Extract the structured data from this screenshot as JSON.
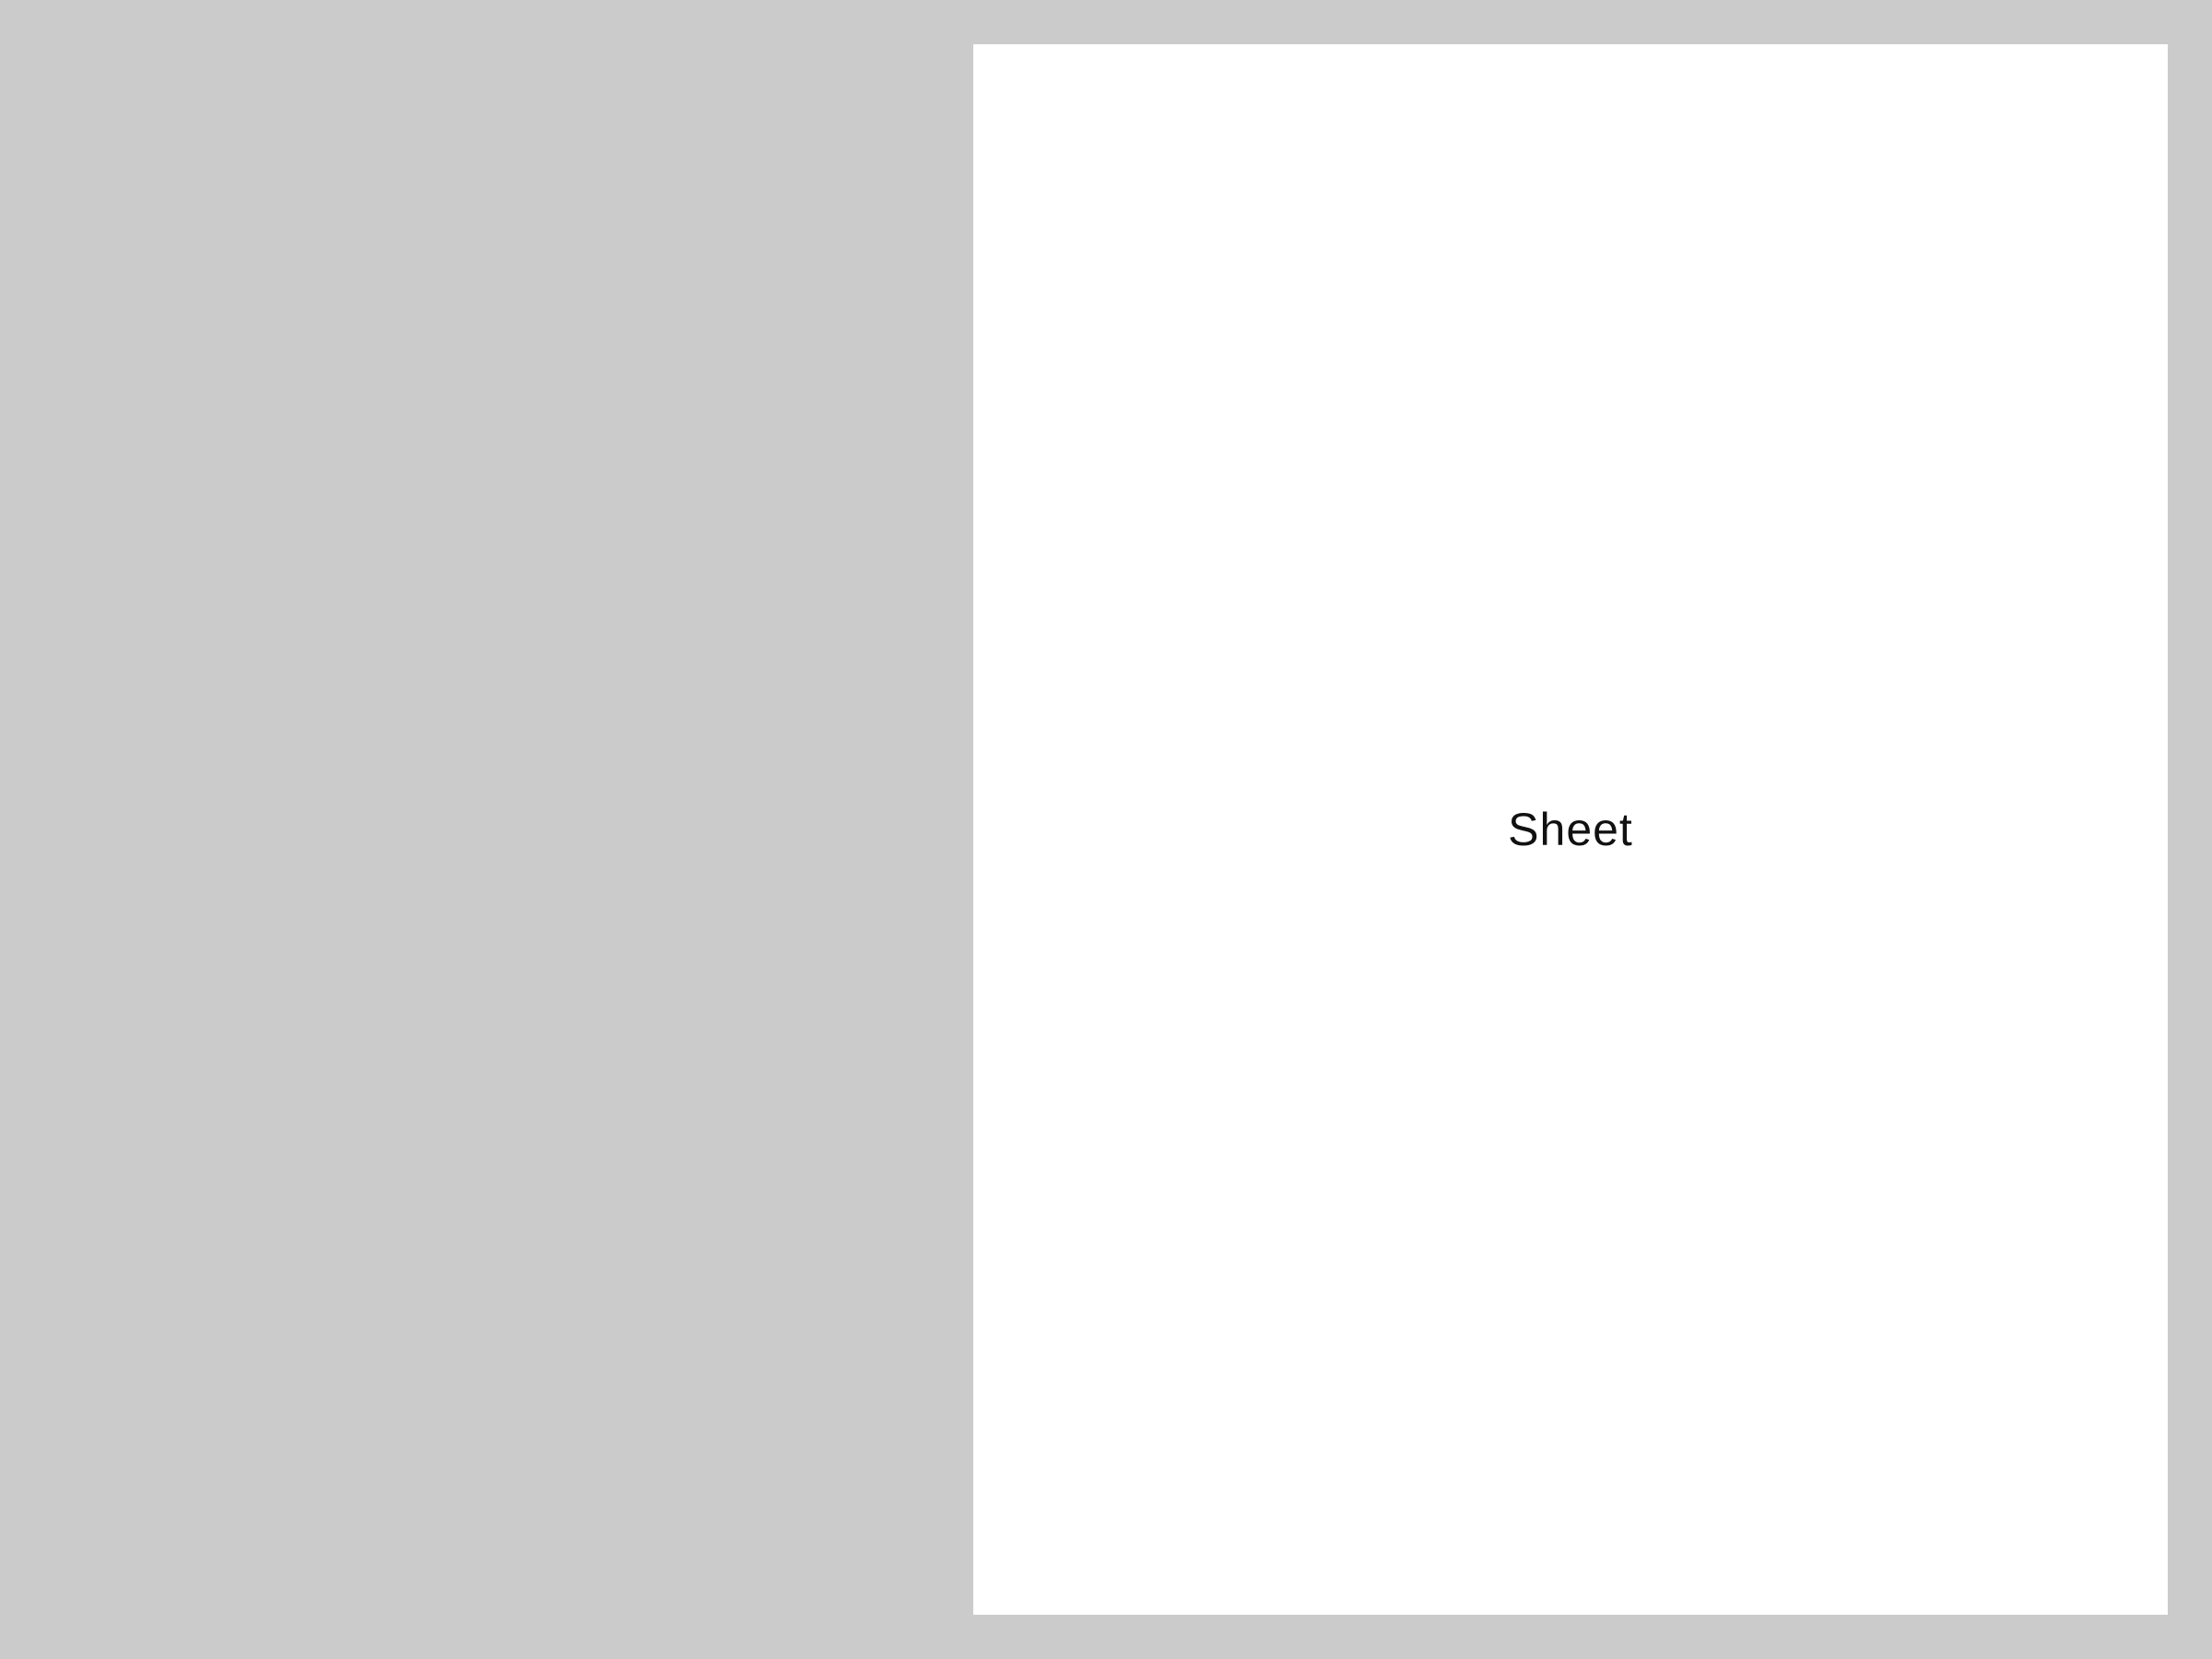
{
  "sheet": {
    "label": "Sheet"
  },
  "colors": {
    "background": "#cbcbcb",
    "sheet": "#ffffff",
    "text": "#111111"
  }
}
